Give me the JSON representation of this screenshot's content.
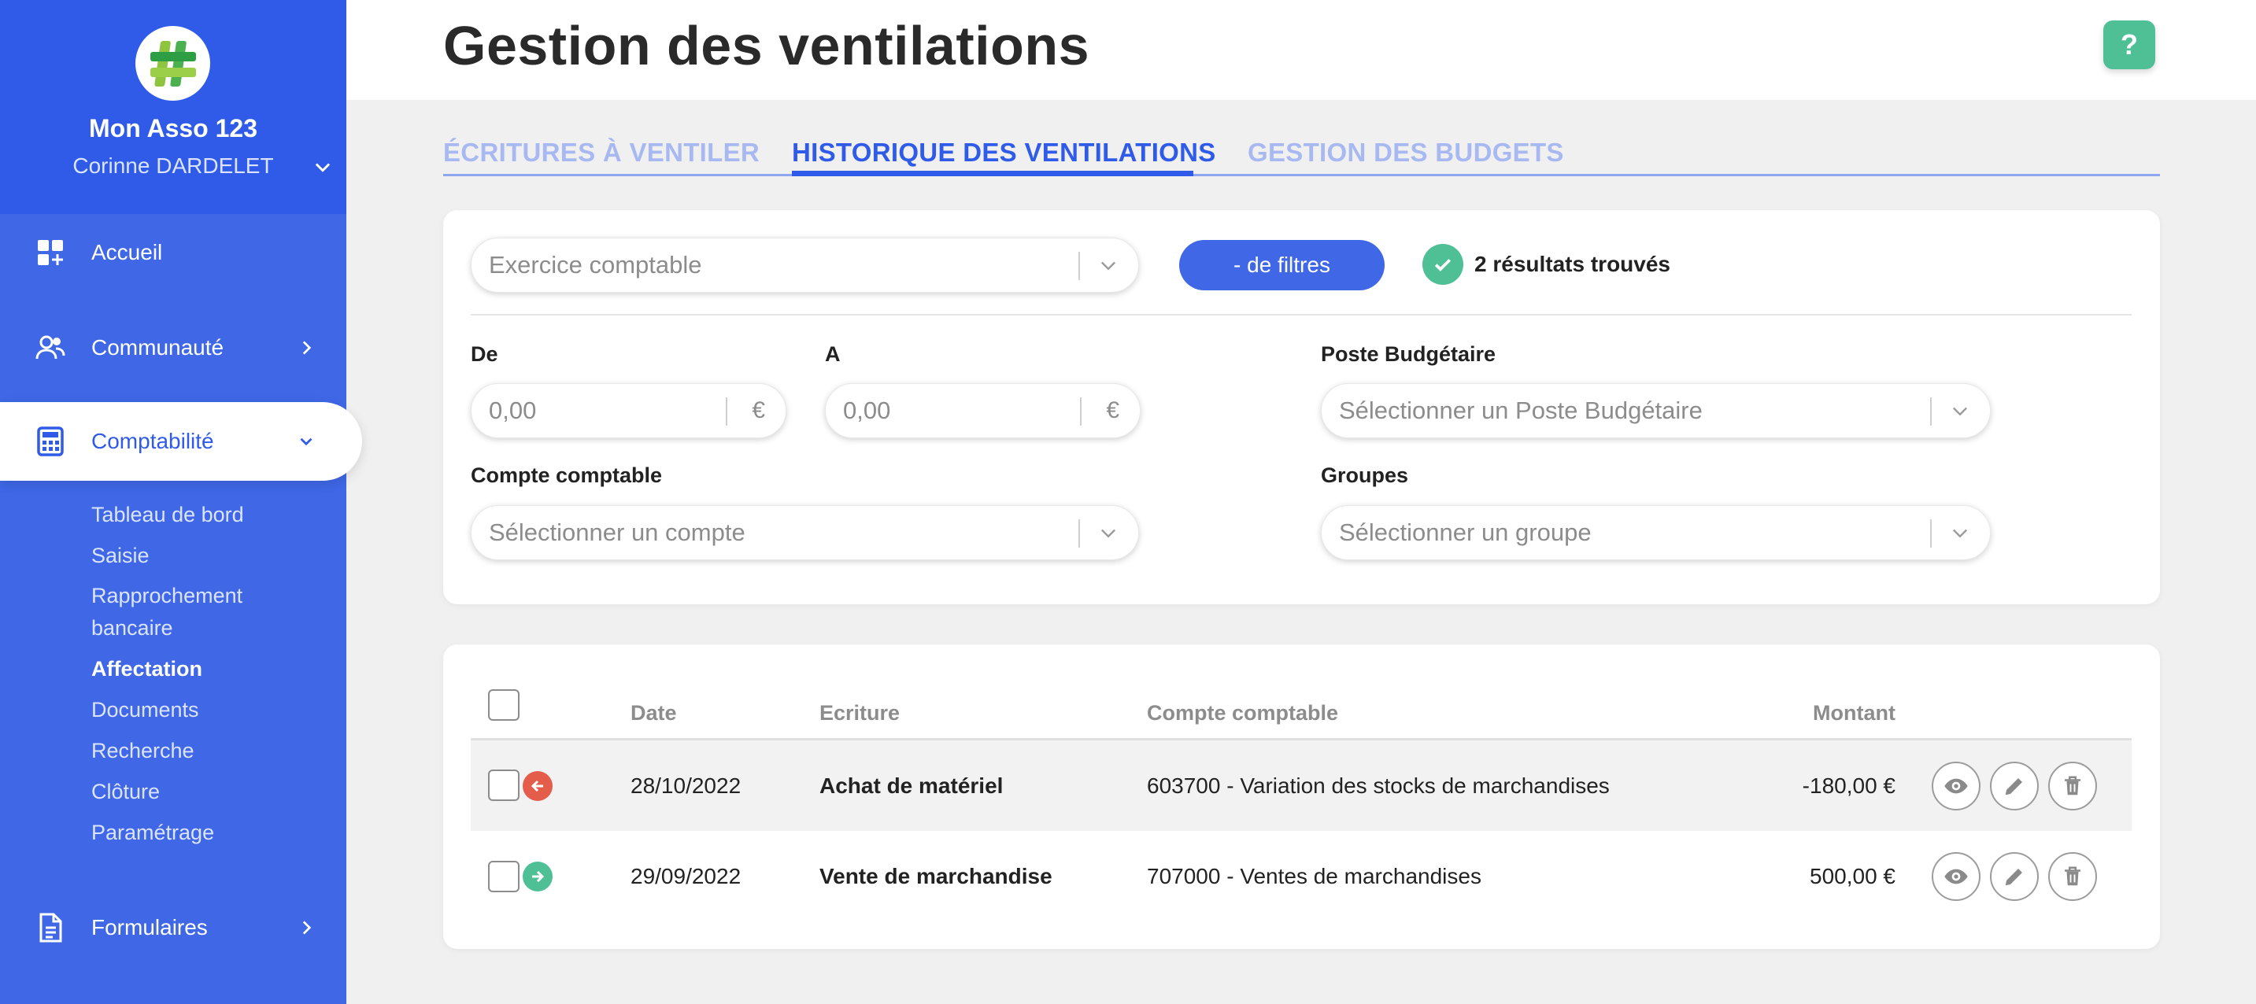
{
  "sidebar": {
    "org_name": "Mon Asso 123",
    "user_name": "Corinne DARDELET",
    "nav": [
      {
        "label": "Accueil",
        "icon": "dashboard-icon"
      },
      {
        "label": "Communauté",
        "icon": "users-icon"
      },
      {
        "label": "Comptabilité",
        "icon": "calculator-icon",
        "active": true
      },
      {
        "label": "Formulaires",
        "icon": "document-icon"
      }
    ],
    "subnav": [
      {
        "label": "Tableau de bord"
      },
      {
        "label": "Saisie"
      },
      {
        "label": "Rapprochement bancaire"
      },
      {
        "label": "Affectation",
        "active": true
      },
      {
        "label": "Documents"
      },
      {
        "label": "Recherche"
      },
      {
        "label": "Clôture"
      },
      {
        "label": "Paramétrage"
      }
    ]
  },
  "header": {
    "title": "Gestion des ventilations",
    "help": "?"
  },
  "tabs": [
    {
      "label": "ÉCRITURES À VENTILER"
    },
    {
      "label": "HISTORIQUE DES VENTILATIONS",
      "active": true
    },
    {
      "label": "GESTION DES BUDGETS"
    }
  ],
  "filters": {
    "exercise_placeholder": "Exercice comptable",
    "toggle_button": "- de filtres",
    "results": "2 résultats trouvés",
    "from_label": "De",
    "from_placeholder": "0,00",
    "to_label": "A",
    "to_placeholder": "0,00",
    "currency": "€",
    "budget_label": "Poste Budgétaire",
    "budget_placeholder": "Sélectionner un Poste Budgétaire",
    "account_label": "Compte comptable",
    "account_placeholder": "Sélectionner un compte",
    "groups_label": "Groupes",
    "groups_placeholder": "Sélectionner un groupe"
  },
  "table": {
    "headers": {
      "date": "Date",
      "entry": "Ecriture",
      "account": "Compte comptable",
      "amount": "Montant"
    },
    "rows": [
      {
        "direction": "out",
        "date": "28/10/2022",
        "entry": "Achat de matériel",
        "account": "603700 - Variation des stocks de marchandises",
        "amount": "-180,00 €"
      },
      {
        "direction": "in",
        "date": "29/09/2022",
        "entry": "Vente de marchandise",
        "account": "707000 - Ventes de marchandises",
        "amount": "500,00 €"
      }
    ]
  },
  "colors": {
    "primary": "#2f5be8",
    "sidebar": "#3f67e6",
    "success": "#4fbf96",
    "danger": "#e35d4a"
  }
}
